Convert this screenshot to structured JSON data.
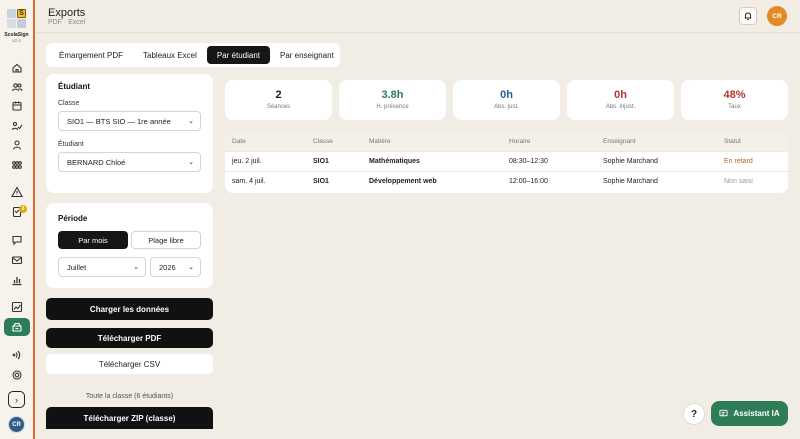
{
  "sidebar": {
    "brand": "ScolaSign",
    "version": "v2.4",
    "logo_letter": "S",
    "notif_count": "3",
    "avatar": "CR",
    "expand_icon": "›",
    "icons": [
      "home-icon",
      "users-icon",
      "calendar-icon",
      "signature-icon",
      "user-icon",
      "groups-icon",
      "alert-icon",
      "document-icon",
      "chat-icon",
      "mail-icon",
      "bar-chart-icon",
      "trend-icon",
      "export-icon",
      "nfc-icon",
      "settings-icon"
    ],
    "active_color": "#2e7d57",
    "accent_color": "#e0672b"
  },
  "header": {
    "title": "Exports",
    "breadcrumb": "PDF · Excel",
    "avatar": "CR",
    "avatar_color": "#e28a25"
  },
  "tabs": [
    {
      "label": "Émargement PDF"
    },
    {
      "label": "Tableaux Excel"
    },
    {
      "label": "Par étudiant"
    },
    {
      "label": "Par enseignant"
    }
  ],
  "student_panel": {
    "title": "Étudiant",
    "class_label": "Classe",
    "class_value": "SIO1 — BTS SIO — 1re année",
    "student_label": "Étudiant",
    "student_value": "BERNARD Chloé"
  },
  "period_panel": {
    "title": "Période",
    "mode_month": "Par mois",
    "mode_range": "Plage libre",
    "month_value": "Juillet",
    "year_value": "2026"
  },
  "actions": {
    "load": "Charger les données",
    "download_pdf": "Télécharger PDF",
    "download_csv": "Télécharger CSV",
    "class_note": "Toute la classe (6 étudiants)",
    "download_zip": "Télécharger ZIP (classe)"
  },
  "stats": [
    {
      "value": "2",
      "label": "Séances",
      "color": "#1c1c1c"
    },
    {
      "value": "3.8h",
      "label": "H. présence",
      "color": "#2e7d57"
    },
    {
      "value": "0h",
      "label": "Abs. just.",
      "color": "#2a5d9a"
    },
    {
      "value": "0h",
      "label": "Abs. injust.",
      "color": "#b2372f"
    },
    {
      "value": "48%",
      "label": "Taux",
      "color": "#b2372f"
    }
  ],
  "table": {
    "headers": [
      "Date",
      "Classe",
      "Matière",
      "Horaire",
      "Enseignant",
      "Statut"
    ],
    "rows": [
      {
        "date": "jeu. 2 juil.",
        "classe": "SIO1",
        "matiere": "Mathématiques",
        "horaire": "08:30–12:30",
        "enseignant": "Sophie Marchand",
        "statut": "En retard",
        "statut_color": "#c0611b"
      },
      {
        "date": "sam. 4 juil.",
        "classe": "SIO1",
        "matiere": "Développement web",
        "horaire": "12:00–16:00",
        "enseignant": "Sophie Marchand",
        "statut": "Non saisi",
        "statut_color": "#999999"
      }
    ]
  },
  "floating": {
    "help": "?",
    "assistant": "Assistant IA"
  }
}
